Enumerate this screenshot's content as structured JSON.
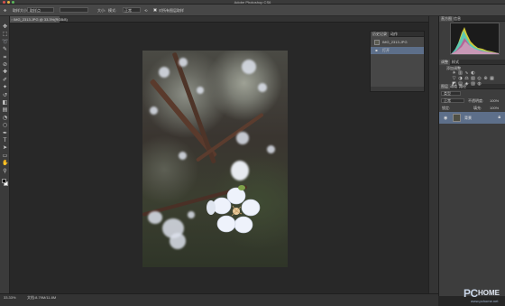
{
  "window": {
    "title": "Adobe Photoshop CS6"
  },
  "options_bar": {
    "tool_icon": "move-tool-icon",
    "sample_label": "取样大小:",
    "sample_value": "取样点",
    "size_label": "大小:",
    "mode_label": "模式:",
    "mode_value": "正常",
    "opacity_label": "不透明度:",
    "opacity_value": "100%",
    "contiguous_label": "对所有图层取样"
  },
  "document": {
    "tab_label": "IMG_2313.JPG @ 33.3%(RGB/8)",
    "zoom": "33.33%",
    "doc_info": "文档:8.79M/11.8M"
  },
  "toolbar": {
    "tools": [
      "move-tool-icon",
      "marquee-tool-icon",
      "lasso-tool-icon",
      "quick-select-tool-icon",
      "crop-tool-icon",
      "eyedropper-tool-icon",
      "healing-tool-icon",
      "brush-tool-icon",
      "clone-stamp-tool-icon",
      "history-brush-tool-icon",
      "eraser-tool-icon",
      "gradient-tool-icon",
      "blur-tool-icon",
      "dodge-tool-icon",
      "pen-tool-icon",
      "type-tool-icon",
      "path-select-tool-icon",
      "shape-tool-icon",
      "hand-tool-icon",
      "zoom-tool-icon"
    ],
    "glyphs": [
      "✥",
      "⬚",
      "➰",
      "✎",
      "⌗",
      "⊘",
      "✚",
      "✐",
      "✦",
      "↺",
      "◧",
      "▤",
      "◔",
      "○",
      "✒",
      "T",
      "➤",
      "▭",
      "✋",
      "⚲"
    ],
    "foreground": "#000000",
    "background": "#ffffff"
  },
  "history_panel": {
    "tabs": [
      "历史记录",
      "动作"
    ],
    "snapshot": "IMG_2313.JPG",
    "items": [
      "打开"
    ]
  },
  "right_panels": {
    "histogram_tabs": [
      "直方图",
      "信息"
    ],
    "adjust_tabs": [
      "调整",
      "样式"
    ],
    "adjust_title": "添加调整",
    "layers_tabs": [
      "图层",
      "通道",
      "路径"
    ],
    "kind_label": "类型",
    "blend_mode": "正常",
    "opacity_label": "不透明度:",
    "opacity_value": "100%",
    "lock_label": "锁定:",
    "fill_label": "填充:",
    "fill_value": "100%",
    "layer_name": "背景"
  },
  "watermark": {
    "main": "PC",
    "sub": "HOME",
    "url": "www.pchome.net"
  }
}
